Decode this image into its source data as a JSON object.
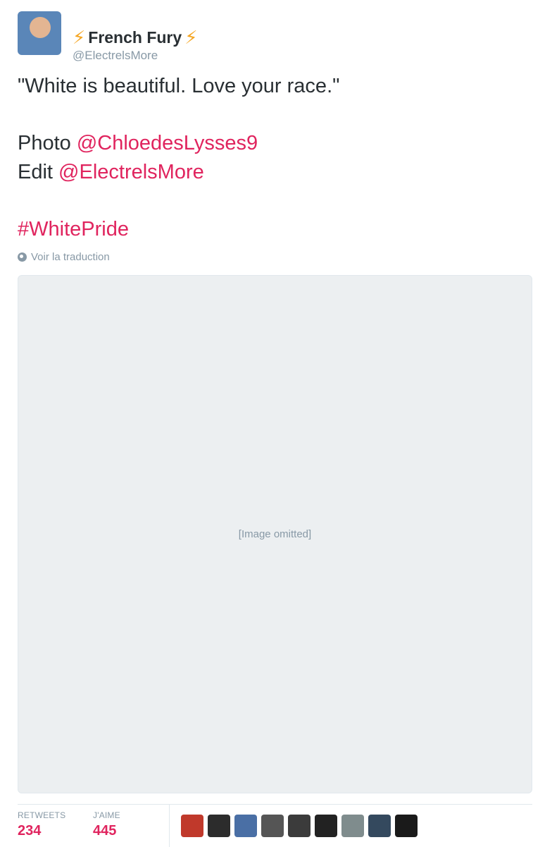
{
  "author": {
    "display_name": "French Fury",
    "handle": "@ElectrelsMore",
    "name_emoji": "⚡"
  },
  "tweet": {
    "line1": "\"White is beautiful. Love your race.\"",
    "photo_label": "Photo ",
    "photo_mention": "@ChloedesLysses9",
    "edit_label": "Edit ",
    "edit_mention": "@ElectrelsMore",
    "hashtag": "#WhitePride"
  },
  "translate_label": "Voir la traduction",
  "media": {
    "placeholder_note": "[Image omitted]"
  },
  "stats": {
    "retweets_label": "RETWEETS",
    "retweets_value": "234",
    "likes_label": "J'AIME",
    "likes_value": "445"
  },
  "colors": {
    "link": "#e0245e",
    "muted": "#8899a6",
    "text": "#292f33"
  },
  "liker_avatar_colors": [
    "#c0392b",
    "#2c2c2c",
    "#4a6fa5",
    "#555555",
    "#3b3b3b",
    "#222222",
    "#7f8c8d",
    "#34495e",
    "#1a1a1a"
  ]
}
